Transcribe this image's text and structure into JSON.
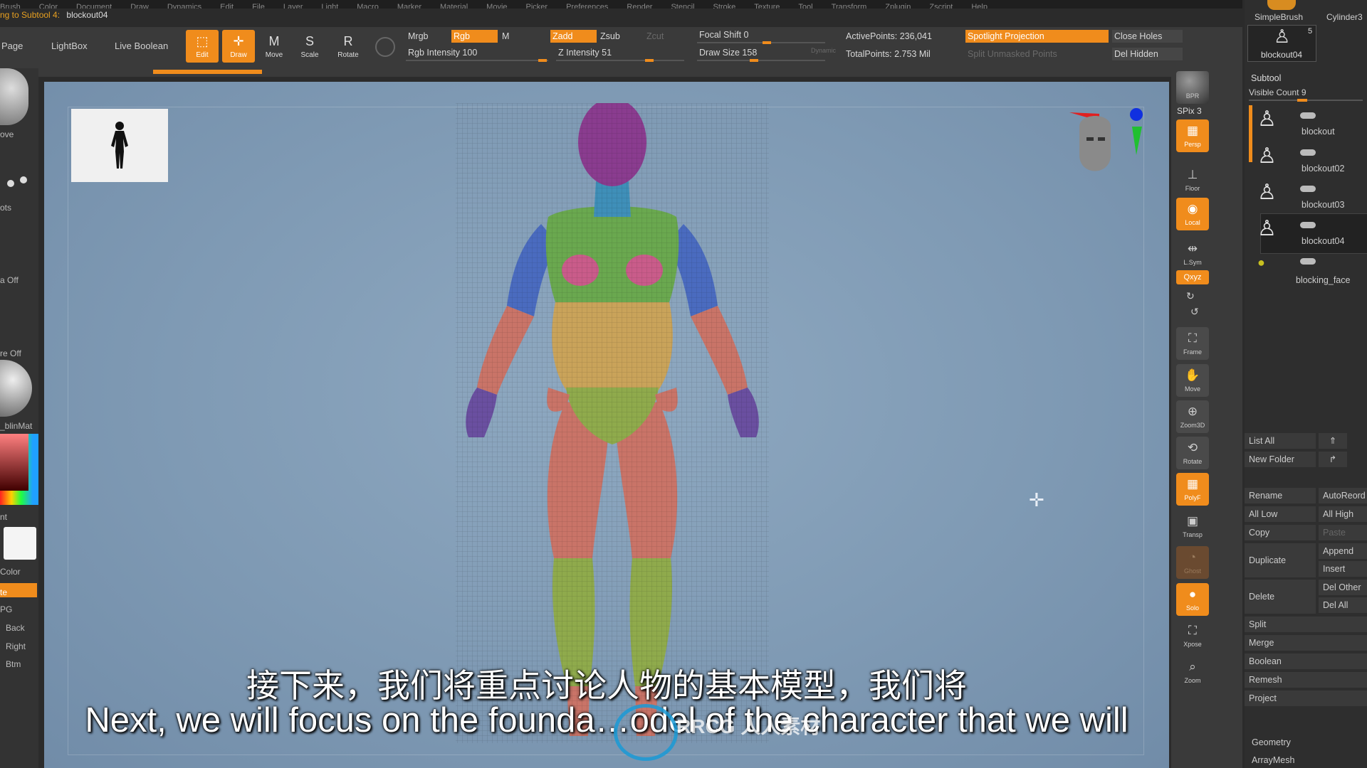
{
  "menu": [
    "Brush",
    "Color",
    "Document",
    "Draw",
    "Dynamics",
    "Edit",
    "File",
    "Layer",
    "Light",
    "Macro",
    "Marker",
    "Material",
    "Movie",
    "Picker",
    "Preferences",
    "Render",
    "Stencil",
    "Stroke",
    "Texture",
    "Tool",
    "Transform",
    "Zplugin",
    "Zscript",
    "Help"
  ],
  "info": {
    "label": "ng to Subtool 4:",
    "value": "blockout04"
  },
  "shelf": {
    "page": "Page",
    "lightbox": "LightBox",
    "live_boolean": "Live Boolean",
    "tools": {
      "edit": "Edit",
      "draw": "Draw",
      "move": "Move",
      "scale": "Scale",
      "rotate": "Rotate"
    },
    "mrgb": "Mrgb",
    "rgb": "Rgb",
    "m": "M",
    "rgb_intensity": "Rgb Intensity 100",
    "zadd": "Zadd",
    "zsub": "Zsub",
    "zcut": "Zcut",
    "z_intensity": "Z Intensity 51",
    "focal_shift": "Focal Shift 0",
    "draw_size": "Draw Size 158",
    "dynamic": "Dynamic",
    "active_points": "ActivePoints: 236,041",
    "total_points": "TotalPoints: 2.753 Mil",
    "spotlight": "Spotlight Projection",
    "split_unmasked": "Split Unmasked Points",
    "close_holes": "Close Holes",
    "del_hidden": "Del Hidden"
  },
  "left": {
    "items": [
      "ove",
      "ots",
      "a Off",
      "re Off",
      "_blinMat",
      "nt",
      "Color",
      "te",
      "PG",
      "Back",
      "Right",
      "Btm"
    ]
  },
  "subtitles": {
    "cn": "接下来，我们将重点讨论人物的基本模型，我们将",
    "en": "Next, we will focus on the founda…odel of the character that we will",
    "watermark": "RRCG 人人素材"
  },
  "right_tools": {
    "bpr": "BPR",
    "spix": "SPix 3",
    "persp": "Persp",
    "floor": "Floor",
    "local": "Local",
    "lsym": "L.Sym",
    "xyz": "Qxyz",
    "frame": "Frame",
    "move": "Move",
    "zoom3d": "Zoom3D",
    "rotate": "Rotate",
    "polyf": "PolyF",
    "transp": "Transp",
    "ghost": "Ghost",
    "solo": "Solo",
    "xpose": "Xpose",
    "zoom": "Zoom"
  },
  "panel": {
    "simplebrush": "SimpleBrush",
    "cylinder": "Cylinder3",
    "current_tool": "blockout04",
    "current_count": "5",
    "subtool_title": "Subtool",
    "visible_count": "Visible Count 9",
    "subtools": [
      "blockout",
      "blockout02",
      "blockout03",
      "blockout04",
      "blocking_face"
    ],
    "list_all": "List All",
    "new_folder": "New Folder",
    "rename": "Rename",
    "autoreorder": "AutoReord",
    "all_low": "All Low",
    "all_high": "All High",
    "copy": "Copy",
    "paste": "Paste",
    "duplicate": "Duplicate",
    "append": "Append",
    "insert": "Insert",
    "delete": "Delete",
    "del_other": "Del Other",
    "del_all": "Del All",
    "split": "Split",
    "merge": "Merge",
    "boolean": "Boolean",
    "remesh": "Remesh",
    "project": "Project",
    "geometry": "Geometry",
    "arraymesh": "ArrayMesh"
  },
  "colors": {
    "accent": "#f08c1c",
    "viewport": "#7f9ab4"
  }
}
